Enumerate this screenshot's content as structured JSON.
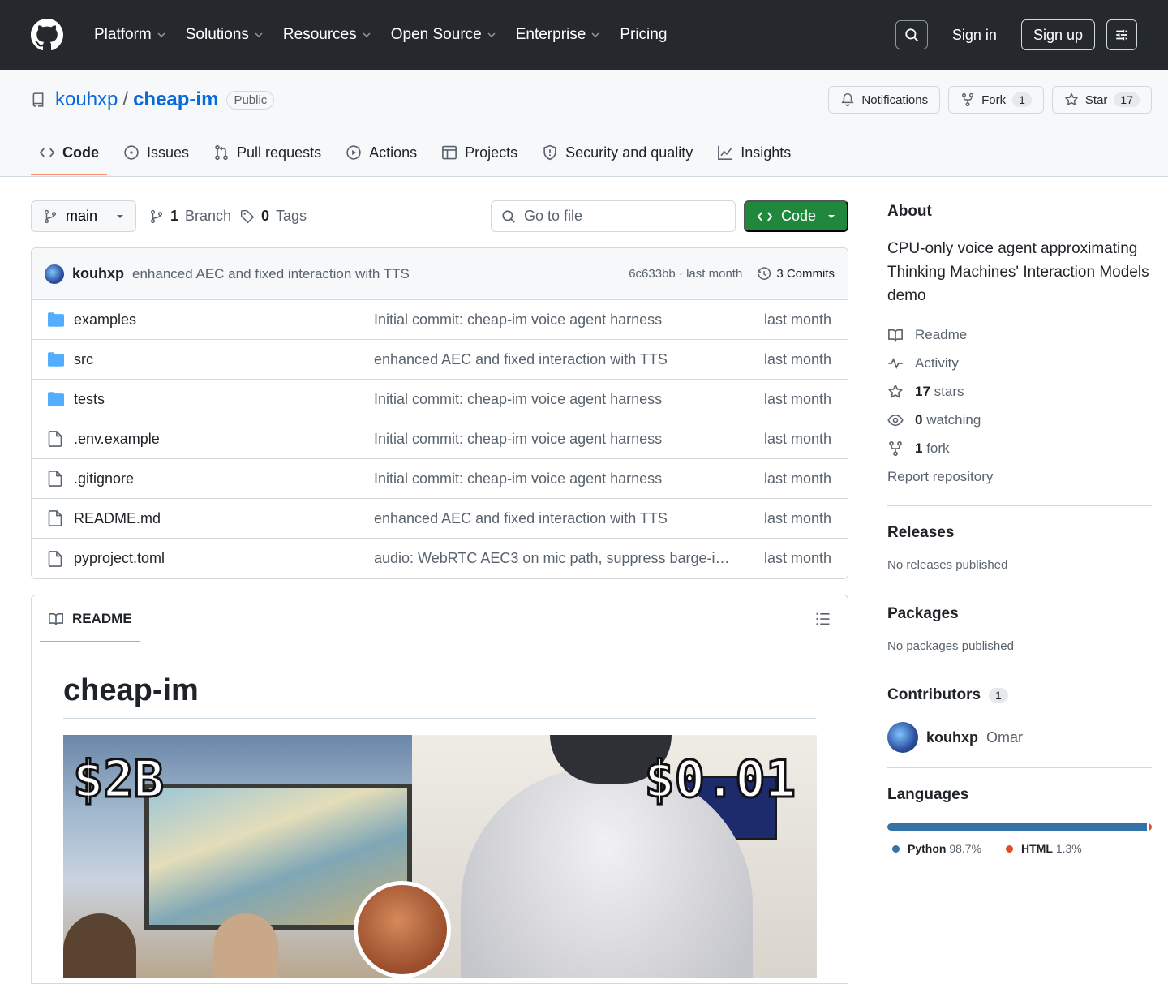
{
  "colors": {
    "nav_bg": "#25292e",
    "link": "#0969da",
    "green": "#1f883d",
    "accent": "#fd8c73",
    "python": "#3572A5",
    "html": "#e34c26"
  },
  "nav": {
    "items": [
      {
        "label": "Platform",
        "dropdown": true
      },
      {
        "label": "Solutions",
        "dropdown": true
      },
      {
        "label": "Resources",
        "dropdown": true
      },
      {
        "label": "Open Source",
        "dropdown": true
      },
      {
        "label": "Enterprise",
        "dropdown": true
      },
      {
        "label": "Pricing",
        "dropdown": false
      }
    ],
    "signin": "Sign in",
    "signup": "Sign up"
  },
  "repo": {
    "owner": "kouhxp",
    "separator": "/",
    "name": "cheap-im",
    "visibility": "Public",
    "notifications": "Notifications",
    "fork_label": "Fork",
    "fork_count": "1",
    "star_label": "Star",
    "star_count": "17"
  },
  "tabs": [
    {
      "label": "Code",
      "icon": "code-icon",
      "active": true
    },
    {
      "label": "Issues",
      "icon": "issue-icon"
    },
    {
      "label": "Pull requests",
      "icon": "pull-request-icon"
    },
    {
      "label": "Actions",
      "icon": "play-icon"
    },
    {
      "label": "Projects",
      "icon": "table-icon"
    },
    {
      "label": "Security and quality",
      "icon": "shield-icon"
    },
    {
      "label": "Insights",
      "icon": "graph-icon"
    }
  ],
  "toolbar": {
    "branch": "main",
    "branch_count": "1",
    "branch_label": "Branch",
    "tag_count": "0",
    "tag_label": "Tags",
    "goto_placeholder": "Go to file",
    "code_button": "Code"
  },
  "commit": {
    "author": "kouhxp",
    "message": "enhanced AEC and fixed interaction with TTS",
    "hash_time": "6c633bb · last month",
    "commits_label": "3 Commits"
  },
  "files": [
    {
      "name": "examples",
      "type": "dir",
      "message": "Initial commit: cheap-im voice agent harness",
      "date": "last month"
    },
    {
      "name": "src",
      "type": "dir",
      "message": "enhanced AEC and fixed interaction with TTS",
      "date": "last month"
    },
    {
      "name": "tests",
      "type": "dir",
      "message": "Initial commit: cheap-im voice agent harness",
      "date": "last month"
    },
    {
      "name": ".env.example",
      "type": "file",
      "message": "Initial commit: cheap-im voice agent harness",
      "date": "last month"
    },
    {
      "name": ".gitignore",
      "type": "file",
      "message": "Initial commit: cheap-im voice agent harness",
      "date": "last month"
    },
    {
      "name": "README.md",
      "type": "file",
      "message": "enhanced AEC and fixed interaction with TTS",
      "date": "last month"
    },
    {
      "name": "pyproject.toml",
      "type": "file",
      "message": "audio: WebRTC AEC3 on mic path, suppress barge-i…",
      "date": "last month"
    }
  ],
  "readme": {
    "tab_label": "README",
    "title": "cheap-im",
    "hero_left_text": "$2B",
    "hero_right_text": "$0.01"
  },
  "about": {
    "heading": "About",
    "description": "CPU-only voice agent approximating Thinking Machines' Interaction Models demo",
    "readme": "Readme",
    "activity": "Activity",
    "stars_count": "17",
    "stars_label": "stars",
    "watching_count": "0",
    "watching_label": "watching",
    "fork_count": "1",
    "fork_label": "fork",
    "report": "Report repository"
  },
  "releases": {
    "heading": "Releases",
    "note": "No releases published"
  },
  "packages": {
    "heading": "Packages",
    "note": "No packages published"
  },
  "contributors": {
    "heading": "Contributors",
    "count": "1",
    "user": "kouhxp",
    "name": "Omar"
  },
  "languages": {
    "heading": "Languages",
    "items": [
      {
        "name": "Python",
        "percent": "98.7%",
        "value": 98.7,
        "color": "#3572A5"
      },
      {
        "name": "HTML",
        "percent": "1.3%",
        "value": 1.3,
        "color": "#e34c26"
      }
    ]
  }
}
